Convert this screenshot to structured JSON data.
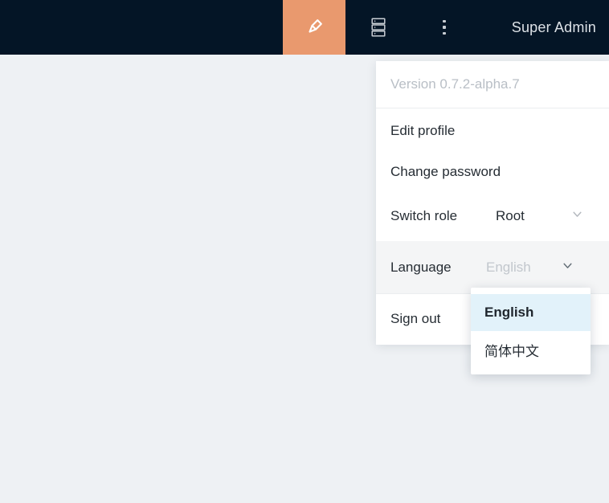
{
  "page": {
    "background": "#eef1f4"
  },
  "topbar": {
    "background": "#041526",
    "active_tile_color": "#e9996e",
    "icons": {
      "active_tool": "highlighter-icon",
      "middle": "server-icon",
      "overflow": "kebab-menu-icon"
    },
    "user_label": "Super Admin"
  },
  "user_menu": {
    "version": "Version 0.7.2-alpha.7",
    "edit_profile": "Edit profile",
    "change_password": "Change password",
    "switch_role": {
      "label": "Switch role",
      "value": "Root"
    },
    "language": {
      "label": "Language",
      "value": "English"
    },
    "sign_out": "Sign out"
  },
  "language_submenu": {
    "highlight_color": "#e2f2fa",
    "options": [
      {
        "label": "English",
        "selected": true
      },
      {
        "label": "简体中文",
        "selected": false
      }
    ]
  }
}
